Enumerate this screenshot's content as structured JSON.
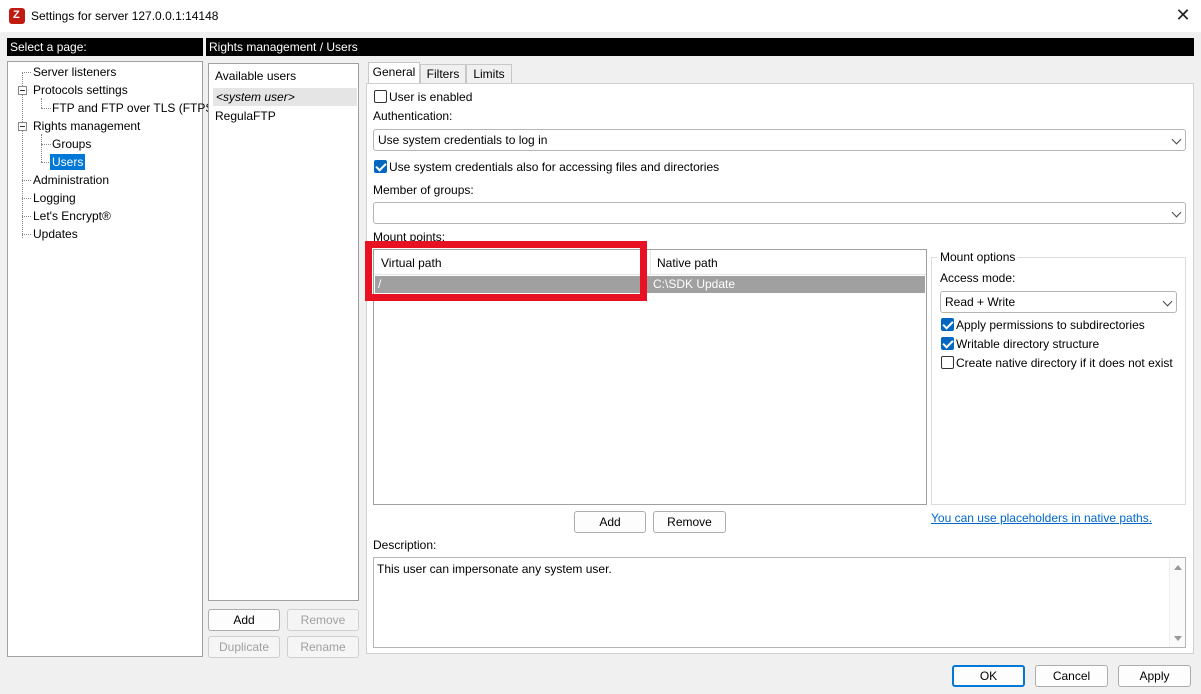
{
  "window": {
    "title": "Settings for server 127.0.0.1:14148",
    "close_glyph": "✕"
  },
  "left_header": "Select a page:",
  "right_header": "Rights management / Users",
  "tree": {
    "server_listeners": "Server listeners",
    "protocols_settings": "Protocols settings",
    "ftp_tls": "FTP and FTP over TLS (FTPS)",
    "rights_management": "Rights management",
    "groups": "Groups",
    "users": "Users",
    "administration": "Administration",
    "logging": "Logging",
    "lets_encrypt": "Let's Encrypt®",
    "updates": "Updates"
  },
  "users_panel": {
    "header": "Available users",
    "items": [
      "<system user>",
      "RegulaFTP"
    ],
    "buttons": {
      "add": "Add",
      "remove": "Remove",
      "duplicate": "Duplicate",
      "rename": "Rename"
    }
  },
  "tabs": [
    "General",
    "Filters",
    "Limits"
  ],
  "general": {
    "user_enabled": "User is enabled",
    "authentication_label": "Authentication:",
    "authentication_value": "Use system credentials to log in",
    "system_credentials_files": "Use system credentials also for accessing files and directories",
    "member_of_groups_label": "Member of groups:",
    "member_of_groups_value": "",
    "mount_points_label": "Mount points:",
    "mount_table": {
      "columns": [
        "Virtual path",
        "Native path"
      ],
      "rows": [
        {
          "virtual": "/",
          "native": "C:\\SDK Update"
        }
      ]
    },
    "mount_add": "Add",
    "mount_remove": "Remove",
    "mount_options": {
      "title": "Mount options",
      "access_mode_label": "Access mode:",
      "access_mode_value": "Read + Write",
      "apply_subdirs": "Apply permissions to subdirectories",
      "writable_structure": "Writable directory structure",
      "create_native": "Create native directory if it does not exist"
    },
    "placeholders_link": "You can use placeholders in native paths.",
    "description_label": "Description:",
    "description_value": "This user can impersonate any system user."
  },
  "footer": {
    "ok": "OK",
    "cancel": "Cancel",
    "apply": "Apply"
  },
  "colors": {
    "highlight": "#e81123",
    "selection": "#0078d7",
    "row_selected": "#a0a0a0"
  }
}
